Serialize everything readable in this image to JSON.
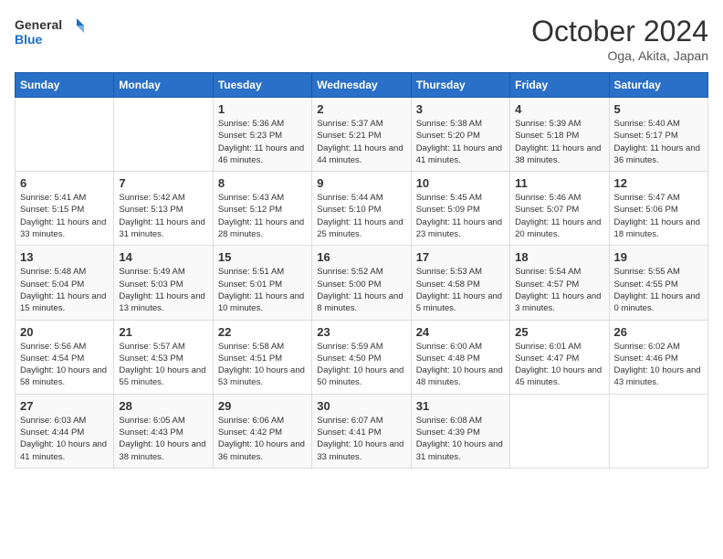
{
  "logo": {
    "general": "General",
    "blue": "Blue"
  },
  "title": "October 2024",
  "subtitle": "Oga, Akita, Japan",
  "days_of_week": [
    "Sunday",
    "Monday",
    "Tuesday",
    "Wednesday",
    "Thursday",
    "Friday",
    "Saturday"
  ],
  "weeks": [
    [
      {
        "day": "",
        "info": ""
      },
      {
        "day": "",
        "info": ""
      },
      {
        "day": "1",
        "info": "Sunrise: 5:36 AM\nSunset: 5:23 PM\nDaylight: 11 hours and 46 minutes."
      },
      {
        "day": "2",
        "info": "Sunrise: 5:37 AM\nSunset: 5:21 PM\nDaylight: 11 hours and 44 minutes."
      },
      {
        "day": "3",
        "info": "Sunrise: 5:38 AM\nSunset: 5:20 PM\nDaylight: 11 hours and 41 minutes."
      },
      {
        "day": "4",
        "info": "Sunrise: 5:39 AM\nSunset: 5:18 PM\nDaylight: 11 hours and 38 minutes."
      },
      {
        "day": "5",
        "info": "Sunrise: 5:40 AM\nSunset: 5:17 PM\nDaylight: 11 hours and 36 minutes."
      }
    ],
    [
      {
        "day": "6",
        "info": "Sunrise: 5:41 AM\nSunset: 5:15 PM\nDaylight: 11 hours and 33 minutes."
      },
      {
        "day": "7",
        "info": "Sunrise: 5:42 AM\nSunset: 5:13 PM\nDaylight: 11 hours and 31 minutes."
      },
      {
        "day": "8",
        "info": "Sunrise: 5:43 AM\nSunset: 5:12 PM\nDaylight: 11 hours and 28 minutes."
      },
      {
        "day": "9",
        "info": "Sunrise: 5:44 AM\nSunset: 5:10 PM\nDaylight: 11 hours and 25 minutes."
      },
      {
        "day": "10",
        "info": "Sunrise: 5:45 AM\nSunset: 5:09 PM\nDaylight: 11 hours and 23 minutes."
      },
      {
        "day": "11",
        "info": "Sunrise: 5:46 AM\nSunset: 5:07 PM\nDaylight: 11 hours and 20 minutes."
      },
      {
        "day": "12",
        "info": "Sunrise: 5:47 AM\nSunset: 5:06 PM\nDaylight: 11 hours and 18 minutes."
      }
    ],
    [
      {
        "day": "13",
        "info": "Sunrise: 5:48 AM\nSunset: 5:04 PM\nDaylight: 11 hours and 15 minutes."
      },
      {
        "day": "14",
        "info": "Sunrise: 5:49 AM\nSunset: 5:03 PM\nDaylight: 11 hours and 13 minutes."
      },
      {
        "day": "15",
        "info": "Sunrise: 5:51 AM\nSunset: 5:01 PM\nDaylight: 11 hours and 10 minutes."
      },
      {
        "day": "16",
        "info": "Sunrise: 5:52 AM\nSunset: 5:00 PM\nDaylight: 11 hours and 8 minutes."
      },
      {
        "day": "17",
        "info": "Sunrise: 5:53 AM\nSunset: 4:58 PM\nDaylight: 11 hours and 5 minutes."
      },
      {
        "day": "18",
        "info": "Sunrise: 5:54 AM\nSunset: 4:57 PM\nDaylight: 11 hours and 3 minutes."
      },
      {
        "day": "19",
        "info": "Sunrise: 5:55 AM\nSunset: 4:55 PM\nDaylight: 11 hours and 0 minutes."
      }
    ],
    [
      {
        "day": "20",
        "info": "Sunrise: 5:56 AM\nSunset: 4:54 PM\nDaylight: 10 hours and 58 minutes."
      },
      {
        "day": "21",
        "info": "Sunrise: 5:57 AM\nSunset: 4:53 PM\nDaylight: 10 hours and 55 minutes."
      },
      {
        "day": "22",
        "info": "Sunrise: 5:58 AM\nSunset: 4:51 PM\nDaylight: 10 hours and 53 minutes."
      },
      {
        "day": "23",
        "info": "Sunrise: 5:59 AM\nSunset: 4:50 PM\nDaylight: 10 hours and 50 minutes."
      },
      {
        "day": "24",
        "info": "Sunrise: 6:00 AM\nSunset: 4:48 PM\nDaylight: 10 hours and 48 minutes."
      },
      {
        "day": "25",
        "info": "Sunrise: 6:01 AM\nSunset: 4:47 PM\nDaylight: 10 hours and 45 minutes."
      },
      {
        "day": "26",
        "info": "Sunrise: 6:02 AM\nSunset: 4:46 PM\nDaylight: 10 hours and 43 minutes."
      }
    ],
    [
      {
        "day": "27",
        "info": "Sunrise: 6:03 AM\nSunset: 4:44 PM\nDaylight: 10 hours and 41 minutes."
      },
      {
        "day": "28",
        "info": "Sunrise: 6:05 AM\nSunset: 4:43 PM\nDaylight: 10 hours and 38 minutes."
      },
      {
        "day": "29",
        "info": "Sunrise: 6:06 AM\nSunset: 4:42 PM\nDaylight: 10 hours and 36 minutes."
      },
      {
        "day": "30",
        "info": "Sunrise: 6:07 AM\nSunset: 4:41 PM\nDaylight: 10 hours and 33 minutes."
      },
      {
        "day": "31",
        "info": "Sunrise: 6:08 AM\nSunset: 4:39 PM\nDaylight: 10 hours and 31 minutes."
      },
      {
        "day": "",
        "info": ""
      },
      {
        "day": "",
        "info": ""
      }
    ]
  ]
}
